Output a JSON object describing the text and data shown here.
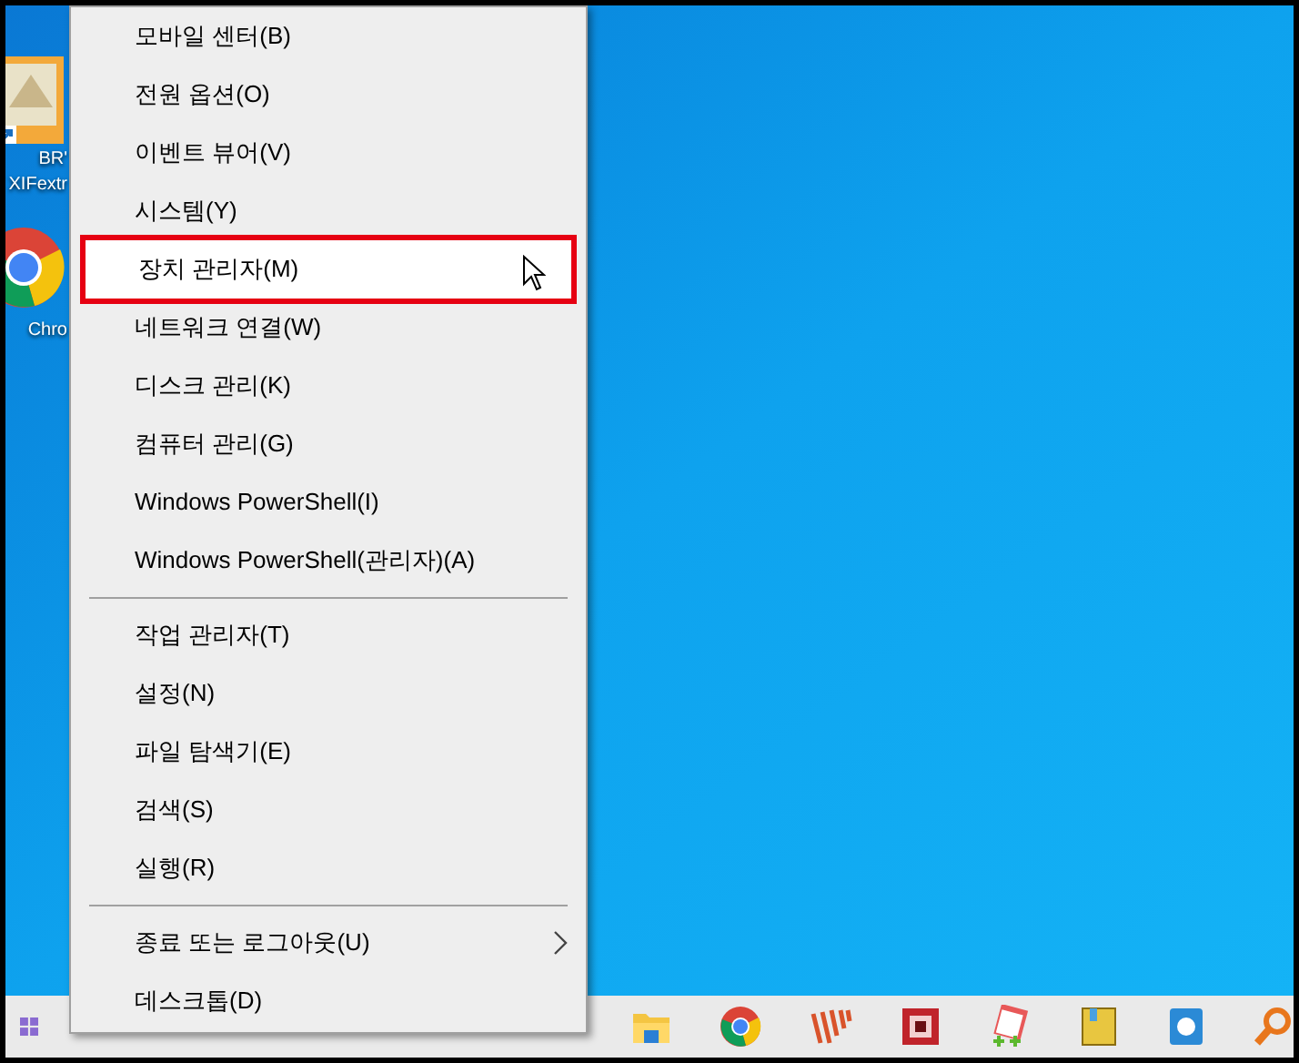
{
  "desktop_icons": [
    {
      "label_lines": [
        "BR'",
        "XIFextr"
      ]
    },
    {
      "label_lines": [
        "Chro"
      ]
    }
  ],
  "context_menu": {
    "items": [
      {
        "kind": "item",
        "label": "모바일 센터(B)",
        "selected": false,
        "submenu": false
      },
      {
        "kind": "item",
        "label": "전원 옵션(O)",
        "selected": false,
        "submenu": false
      },
      {
        "kind": "item",
        "label": "이벤트 뷰어(V)",
        "selected": false,
        "submenu": false
      },
      {
        "kind": "item",
        "label": "시스템(Y)",
        "selected": false,
        "submenu": false
      },
      {
        "kind": "item",
        "label": "장치 관리자(M)",
        "selected": true,
        "submenu": false
      },
      {
        "kind": "item",
        "label": "네트워크 연결(W)",
        "selected": false,
        "submenu": false
      },
      {
        "kind": "item",
        "label": "디스크 관리(K)",
        "selected": false,
        "submenu": false
      },
      {
        "kind": "item",
        "label": "컴퓨터 관리(G)",
        "selected": false,
        "submenu": false
      },
      {
        "kind": "item",
        "label": "Windows PowerShell(I)",
        "selected": false,
        "submenu": false
      },
      {
        "kind": "item",
        "label": "Windows PowerShell(관리자)(A)",
        "selected": false,
        "submenu": false
      },
      {
        "kind": "separator"
      },
      {
        "kind": "item",
        "label": "작업 관리자(T)",
        "selected": false,
        "submenu": false
      },
      {
        "kind": "item",
        "label": "설정(N)",
        "selected": false,
        "submenu": false
      },
      {
        "kind": "item",
        "label": "파일 탐색기(E)",
        "selected": false,
        "submenu": false
      },
      {
        "kind": "item",
        "label": "검색(S)",
        "selected": false,
        "submenu": false
      },
      {
        "kind": "item",
        "label": "실행(R)",
        "selected": false,
        "submenu": false
      },
      {
        "kind": "separator"
      },
      {
        "kind": "item",
        "label": "종료 또는 로그아웃(U)",
        "selected": false,
        "submenu": true
      },
      {
        "kind": "item",
        "label": "데스크톱(D)",
        "selected": false,
        "submenu": false
      }
    ]
  }
}
